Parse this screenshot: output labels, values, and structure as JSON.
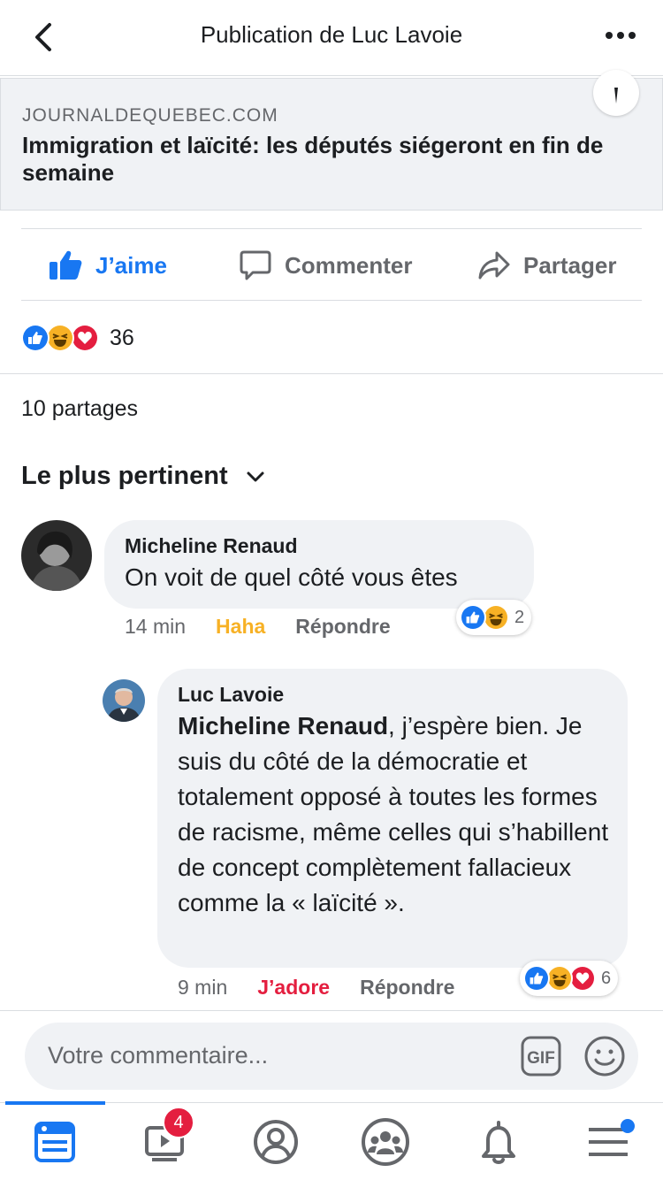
{
  "header": {
    "title": "Publication de Luc Lavoie",
    "back_icon": "chevron-left-icon",
    "more_icon": "more-dots-icon"
  },
  "link_preview": {
    "domain": "JOURNALDEQUEBEC.COM",
    "headline": "Immigration et laïcité: les députés siégeront en fin de semaine"
  },
  "actions": {
    "like": "J’aime",
    "comment": "Commenter",
    "share": "Partager"
  },
  "reactions_summary": {
    "count": "36",
    "icons": [
      "like-reaction-icon",
      "haha-reaction-icon",
      "love-reaction-icon"
    ]
  },
  "shares": "10 partages",
  "sort_label": "Le plus pertinent",
  "comments": [
    {
      "author": "Micheline Renaud",
      "text": "On voit de quel côté vous êtes",
      "time": "14 min",
      "my_reaction": "Haha",
      "reply": "Répondre",
      "reaction_count": "2"
    },
    {
      "author": "Luc Lavoie",
      "mention": "Micheline Renaud",
      "text": ", j’espère bien. Je suis du côté de la démocratie et totalement opposé à toutes les formes de racisme, même celles qui s’habillent de concept complètement fallacieux comme la « laïcité ».",
      "time": "9 min",
      "my_reaction": "J’adore",
      "reply": "Répondre",
      "reaction_count": "6"
    }
  ],
  "composer": {
    "placeholder": "Votre commentaire...",
    "gif_label": "GIF"
  },
  "tabbar": {
    "video_badge": "4"
  },
  "colors": {
    "accent": "#1877f2",
    "haha": "#f7b125",
    "love": "#e41e3f",
    "bubble": "#f0f2f5",
    "muted": "#65676b"
  }
}
